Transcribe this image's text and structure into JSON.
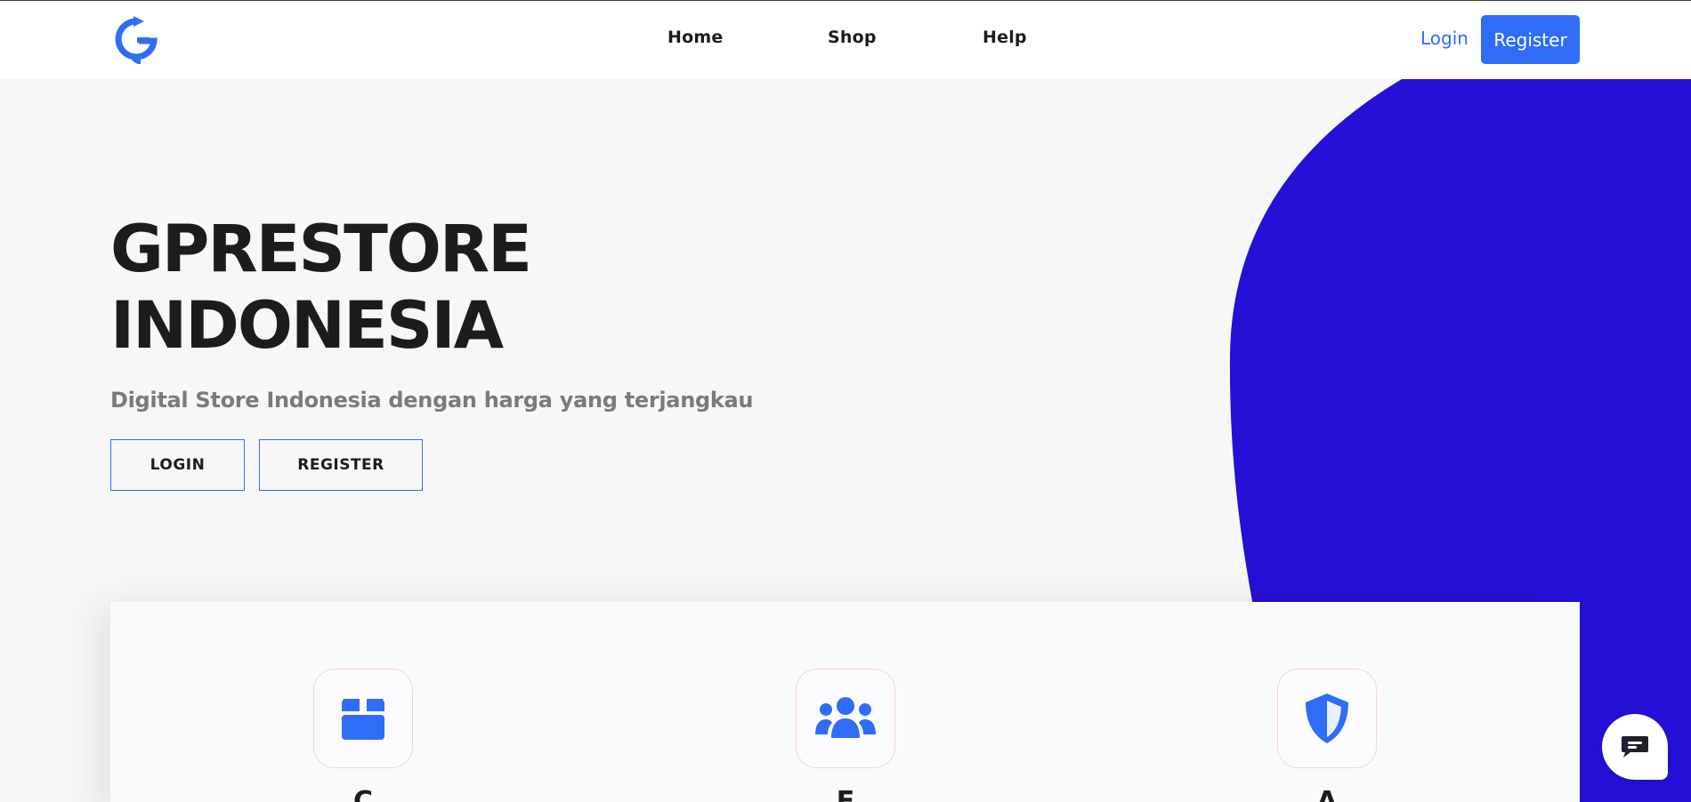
{
  "brand": {
    "logo_icon": "g-refresh-logo-icon",
    "accent_color": "#2f6df6",
    "blob_color": "#2610d8"
  },
  "nav": {
    "links": [
      {
        "label": "Home"
      },
      {
        "label": "Shop"
      },
      {
        "label": "Help"
      }
    ],
    "login_label": "Login",
    "register_label": "Register"
  },
  "hero": {
    "title_line1": "GPRESTORE",
    "title_line2": "INDONESIA",
    "subtitle": "Digital Store Indonesia dengan harga yang terjangkau",
    "login_button": "LOGIN",
    "register_button": "REGISTER"
  },
  "features": [
    {
      "icon": "box-icon",
      "title": "C"
    },
    {
      "icon": "users-icon",
      "title": "E"
    },
    {
      "icon": "shield-icon",
      "title": "A"
    }
  ],
  "chat": {
    "icon": "chat-bubble-icon"
  }
}
